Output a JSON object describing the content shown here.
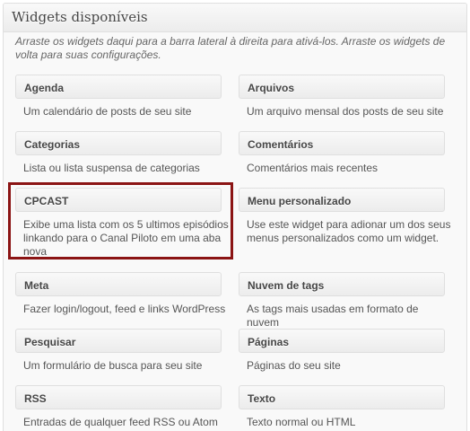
{
  "panel": {
    "title": "Widgets disponíveis",
    "description": "Arraste os widgets daqui para a barra lateral à direita para ativá-los. Arraste os widgets de volta para suas configurações."
  },
  "widgets": [
    {
      "title": "Agenda",
      "description": "Um calendário de posts de seu site"
    },
    {
      "title": "Arquivos",
      "description": "Um arquivo mensal dos posts de seu site"
    },
    {
      "title": "Categorias",
      "description": "Lista ou lista suspensa de categorias"
    },
    {
      "title": "Comentários",
      "description": "Comentários mais recentes"
    },
    {
      "title": "CPCAST",
      "description": "Exibe uma lista com os 5 ultimos episódios linkando para o Canal Piloto em uma aba nova"
    },
    {
      "title": "Menu personalizado",
      "description": "Use este widget para adionar um dos seus menus personalizados como um widget."
    },
    {
      "title": "Meta",
      "description": "Fazer login/logout, feed e links WordPress"
    },
    {
      "title": "Nuvem de tags",
      "description": "As tags mais usadas em formato de nuvem"
    },
    {
      "title": "Pesquisar",
      "description": "Um formulário de busca para seu site"
    },
    {
      "title": "Páginas",
      "description": "Páginas do seu site"
    },
    {
      "title": "RSS",
      "description": "Entradas de qualquer feed RSS ou Atom"
    },
    {
      "title": "Texto",
      "description": "Texto normal ou HTML"
    }
  ],
  "highlight": {
    "color": "#8b1414",
    "target": "CPCAST"
  }
}
